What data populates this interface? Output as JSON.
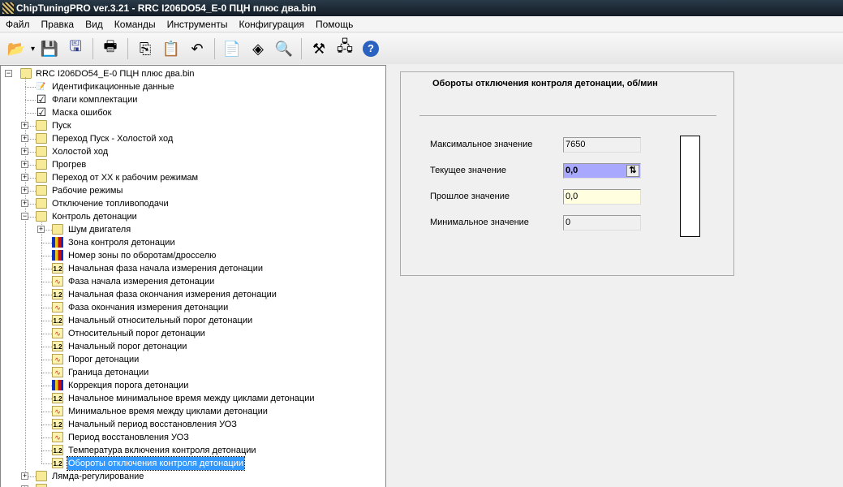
{
  "window": {
    "title": "ChipTuningPRO ver.3.21 - RRC I206DO54_E-0 ПЦН плюс два.bin"
  },
  "menu": [
    "Файл",
    "Правка",
    "Вид",
    "Команды",
    "Инструменты",
    "Конфигурация",
    "Помощь"
  ],
  "toolbar": [
    "open-icon",
    "save-icon",
    "save-as-icon",
    "print-icon",
    "copy-icon",
    "paste-icon",
    "undo-icon",
    "document-icon",
    "info-icon",
    "search-icon",
    "tools-icon",
    "network-icon",
    "help-icon"
  ],
  "tree": {
    "root": "RRC I206DO54_E-0 ПЦН плюс два.bin",
    "items": [
      {
        "label": "Идентификационные данные",
        "level": 1,
        "icon": "doc"
      },
      {
        "label": "Флаги комплектации",
        "level": 1,
        "icon": "check"
      },
      {
        "label": "Маска ошибок",
        "level": 1,
        "icon": "check"
      },
      {
        "label": "Пуск",
        "level": 1,
        "icon": "folder",
        "exp": "+"
      },
      {
        "label": "Переход Пуск - Холостой ход",
        "level": 1,
        "icon": "folder",
        "exp": "+"
      },
      {
        "label": "Холостой ход",
        "level": 1,
        "icon": "folder",
        "exp": "+"
      },
      {
        "label": "Прогрев",
        "level": 1,
        "icon": "folder",
        "exp": "+"
      },
      {
        "label": "Переход от ХХ к рабочим режимам",
        "level": 1,
        "icon": "folder",
        "exp": "+"
      },
      {
        "label": "Рабочие режимы",
        "level": 1,
        "icon": "folder",
        "exp": "+"
      },
      {
        "label": "Отключение топливоподачи",
        "level": 1,
        "icon": "folder",
        "exp": "+"
      },
      {
        "label": "Контроль детонации",
        "level": 1,
        "icon": "folder",
        "exp": "−"
      },
      {
        "label": "Шум двигателя",
        "level": 2,
        "icon": "folder",
        "exp": "+"
      },
      {
        "label": "Зона контроля детонации",
        "level": 2,
        "icon": "bars"
      },
      {
        "label": "Номер зоны по оборотам/дросселю",
        "level": 2,
        "icon": "bars"
      },
      {
        "label": "Начальная фаза начала измерения детонации",
        "level": 2,
        "icon": "num"
      },
      {
        "label": "Фаза начала измерения детонации",
        "level": 2,
        "icon": "graph"
      },
      {
        "label": "Начальная фаза окончания измерения детонации",
        "level": 2,
        "icon": "num"
      },
      {
        "label": "Фаза окончания измерения детонации",
        "level": 2,
        "icon": "graph"
      },
      {
        "label": "Начальный относительный порог детонации",
        "level": 2,
        "icon": "num"
      },
      {
        "label": "Относительный порог детонации",
        "level": 2,
        "icon": "graph"
      },
      {
        "label": "Начальный порог детонации",
        "level": 2,
        "icon": "num"
      },
      {
        "label": "Порог детонации",
        "level": 2,
        "icon": "graph"
      },
      {
        "label": "Граница детонации",
        "level": 2,
        "icon": "graph"
      },
      {
        "label": "Коррекция порога детонации",
        "level": 2,
        "icon": "bars"
      },
      {
        "label": "Начальное минимальное время между циклами детонации",
        "level": 2,
        "icon": "num"
      },
      {
        "label": "Минимальное время между циклами детонации",
        "level": 2,
        "icon": "graph"
      },
      {
        "label": "Начальный период восстановления УОЗ",
        "level": 2,
        "icon": "num"
      },
      {
        "label": "Период восстановления УОЗ",
        "level": 2,
        "icon": "graph"
      },
      {
        "label": "Температура включения контроля детонации",
        "level": 2,
        "icon": "num"
      },
      {
        "label": "Обороты отключения контроля детонации",
        "level": 2,
        "icon": "num",
        "selected": true
      },
      {
        "label": "Лямда-регулирование",
        "level": 1,
        "icon": "folder",
        "exp": "+"
      },
      {
        "label": "",
        "level": 1,
        "icon": "folder",
        "exp": "+"
      }
    ]
  },
  "panel": {
    "title": "Обороты отключения контроля детонации, об/мин",
    "fields": [
      {
        "label": "Максимальное значение",
        "value": "7650",
        "style": "readonly"
      },
      {
        "label": "Текущее значение",
        "value": "0,0",
        "style": "current"
      },
      {
        "label": "Прошлое значение",
        "value": "0,0",
        "style": "previous"
      },
      {
        "label": "Минимальное значение",
        "value": "0",
        "style": "readonly"
      }
    ],
    "level_fraction": 0
  },
  "colors": {
    "current_bg": "#a8a8ff",
    "previous_bg": "#ffffe0",
    "selection": "#3399ff"
  }
}
